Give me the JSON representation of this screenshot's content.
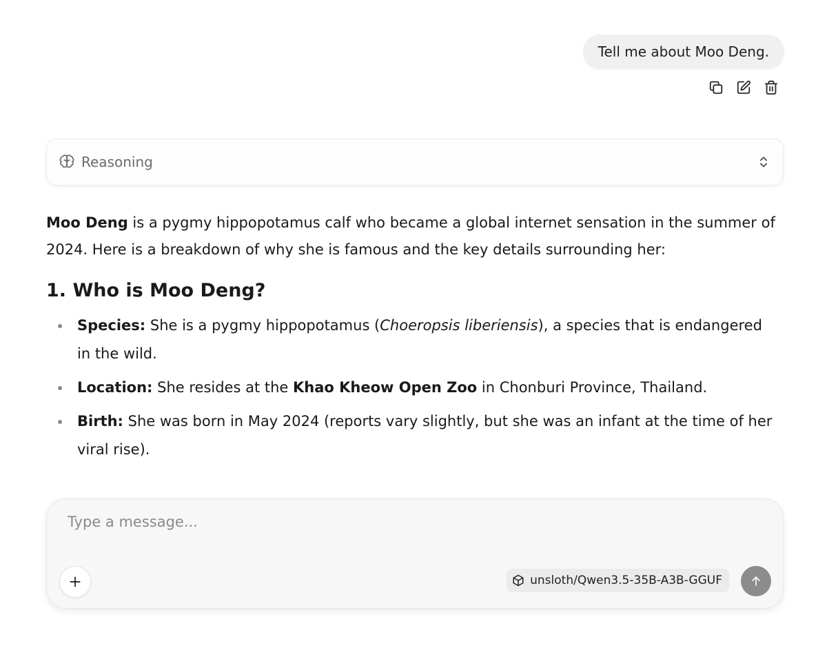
{
  "user_message": {
    "text": "Tell me about Moo Deng.",
    "actions": [
      {
        "name": "copy",
        "icon": "copy-icon"
      },
      {
        "name": "edit",
        "icon": "edit-icon"
      },
      {
        "name": "delete",
        "icon": "trash-icon"
      }
    ]
  },
  "reasoning": {
    "label": "Reasoning",
    "icon": "brain-icon",
    "toggle_icon": "chevrons-up-down-icon"
  },
  "answer": {
    "intro_bold": "Moo Deng",
    "intro_rest": " is a pygmy hippopotamus calf who became a global internet sensation in the summer of 2024. Here is a breakdown of why she is famous and the key details surrounding her:",
    "heading": "1. Who is Moo Deng?",
    "bullets": {
      "species": {
        "label": "Species:",
        "before": " She is a pygmy hippopotamus (",
        "italic": "Choeropsis liberiensis",
        "after": "), a species that is endangered in the wild."
      },
      "location": {
        "label": "Location:",
        "before": " She resides at the ",
        "bold": "Khao Kheow Open Zoo",
        "after": " in Chonburi Province, Thailand."
      },
      "birth": {
        "label": "Birth:",
        "text": " She was born in May 2024 (reports vary slightly, but she was an infant at the time of her viral rise)."
      }
    }
  },
  "composer": {
    "placeholder": "Type a message...",
    "attach_icon": "plus-icon",
    "model_icon": "cube-icon",
    "model_name": "unsloth/Qwen3.5-35B-A3B-GGUF",
    "send_icon": "arrow-up-icon"
  }
}
